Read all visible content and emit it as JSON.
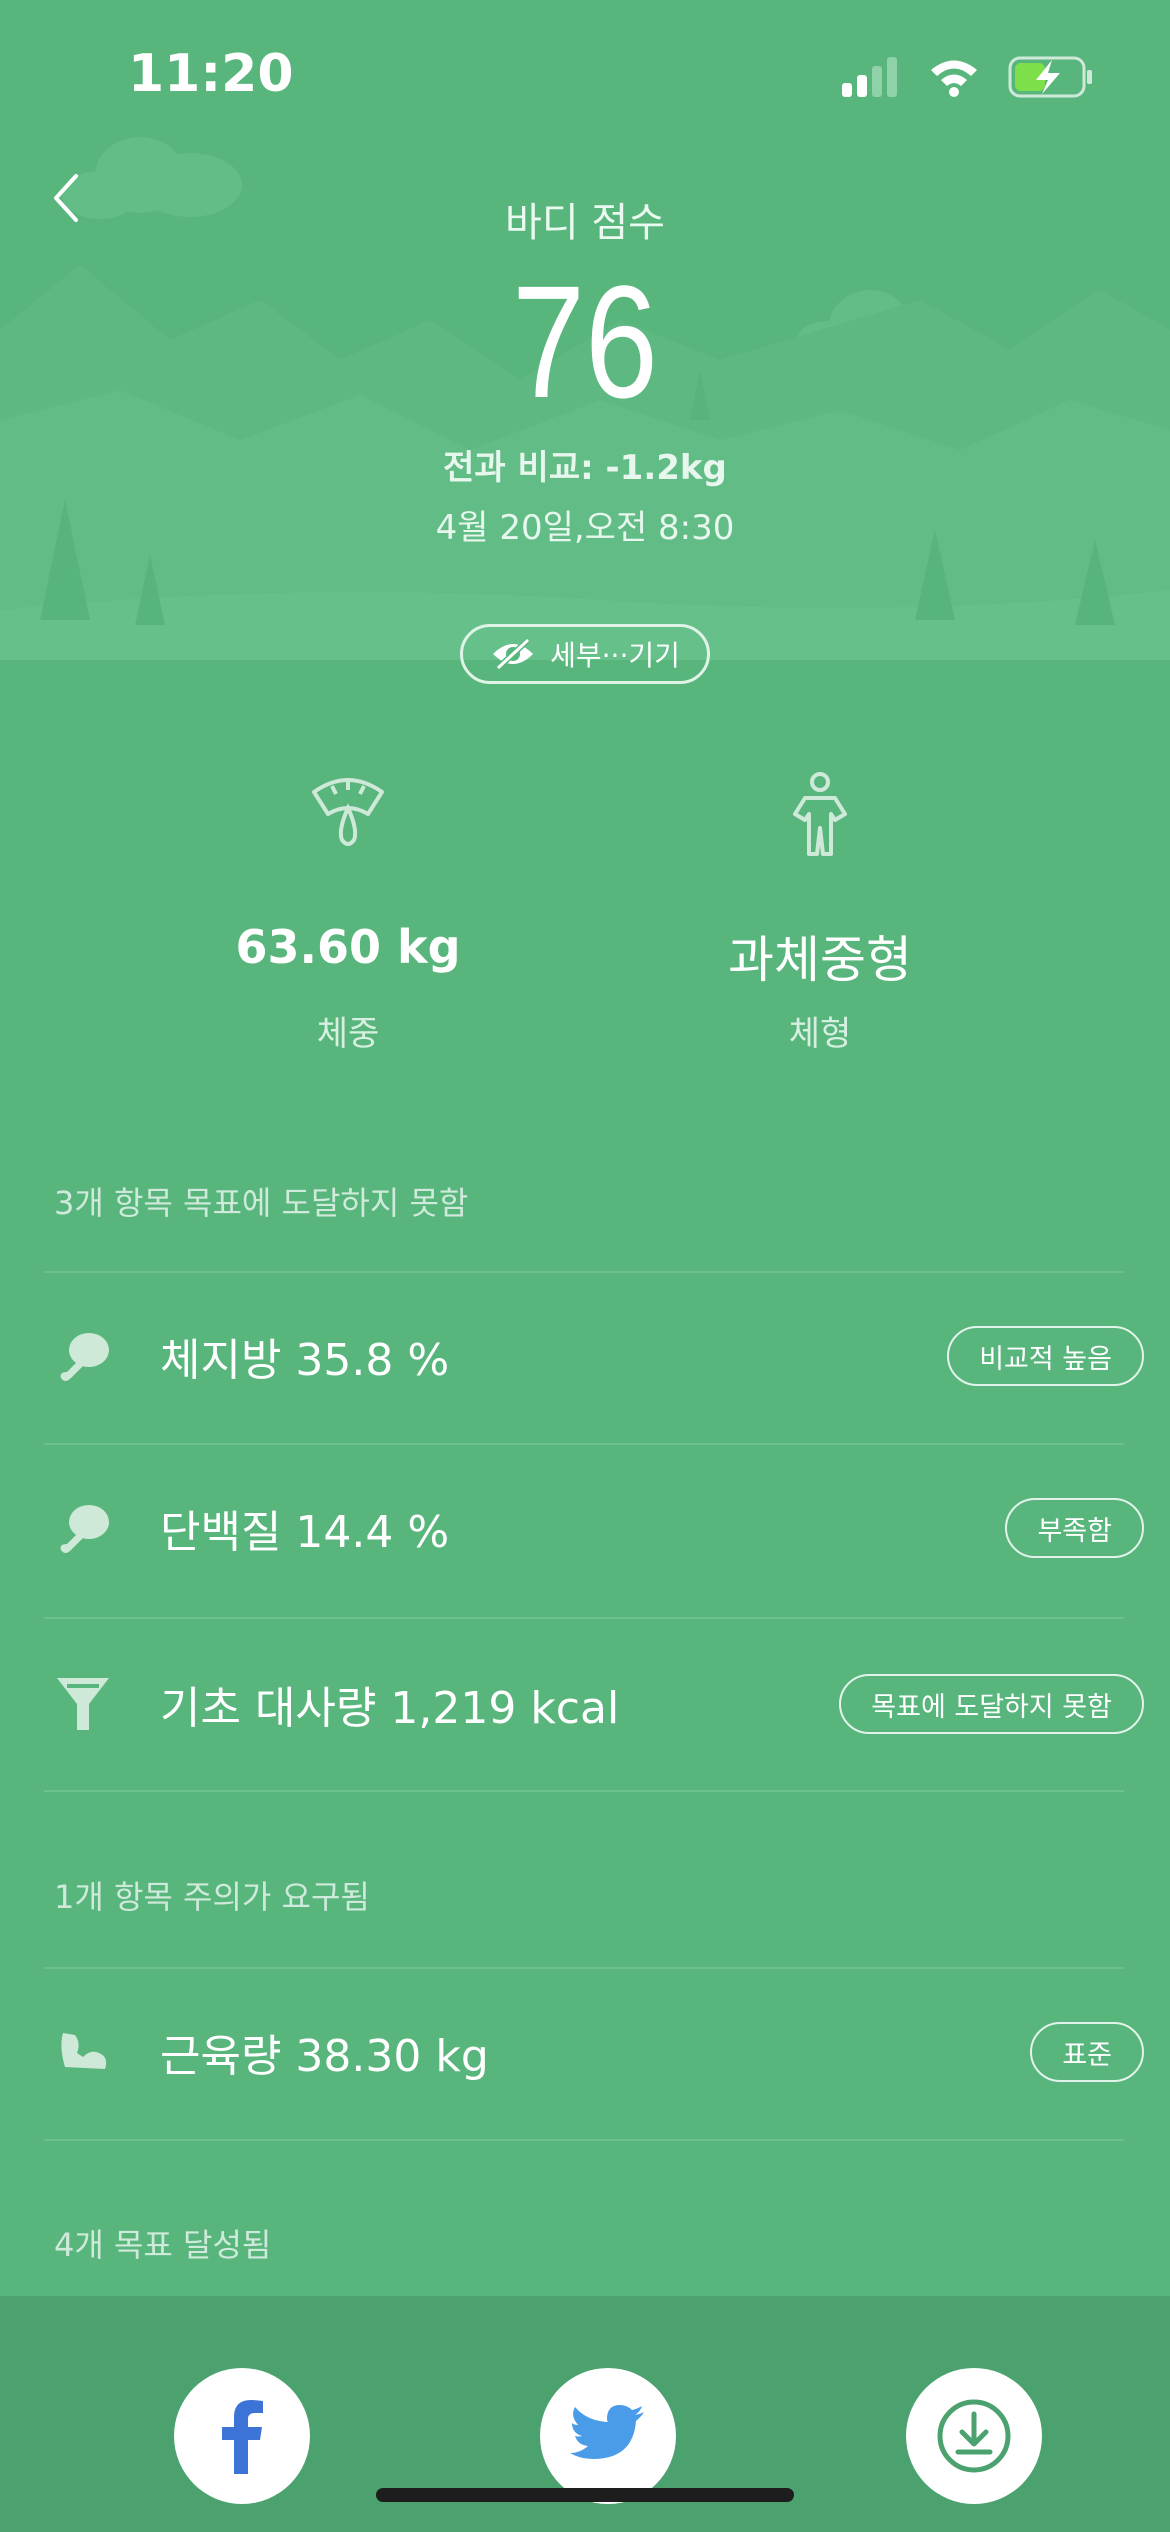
{
  "status_bar": {
    "time": "11:20",
    "icons": [
      "signal-icon",
      "wifi-icon",
      "battery-charging-icon"
    ]
  },
  "header": {
    "back_icon": "chevron-left-icon",
    "title": "바디 점수",
    "score": "76",
    "compare": "전과 비교: -1.2kg",
    "date": "4월 20일,오전 8:30",
    "detail_toggle": {
      "icon": "eye-off-icon",
      "label": "세부···기기"
    }
  },
  "metrics": [
    {
      "icon": "scale-icon",
      "value": "63.60 kg",
      "label": "체중"
    },
    {
      "icon": "body-figure-icon",
      "value": "과체중형",
      "label": "체형"
    }
  ],
  "sections": {
    "not_reached": {
      "caption": "3개 항목 목표에 도달하지 못함",
      "items": [
        {
          "icon": "drumstick-icon",
          "text": "체지방 35.8 %",
          "badge": "비교적 높음"
        },
        {
          "icon": "drumstick-icon",
          "text": "단백질 14.4 %",
          "badge": "부족함"
        },
        {
          "icon": "funnel-icon",
          "text": "기초 대사량 1,219 kcal",
          "badge": "목표에 도달하지 못함"
        }
      ]
    },
    "attention": {
      "caption": "1개 항목 주의가 요구됨",
      "items": [
        {
          "icon": "muscle-arm-icon",
          "text": "근육량 38.30 kg",
          "badge": "표준"
        }
      ]
    },
    "achieved": {
      "caption": "4개 목표 달성됨"
    }
  },
  "share_bar": {
    "buttons": [
      "facebook-icon",
      "twitter-icon",
      "download-icon"
    ]
  },
  "colors": {
    "background": "#58b67d",
    "bottom_bar": "#4ba26f",
    "icon_tint": "#cfe9d9"
  }
}
